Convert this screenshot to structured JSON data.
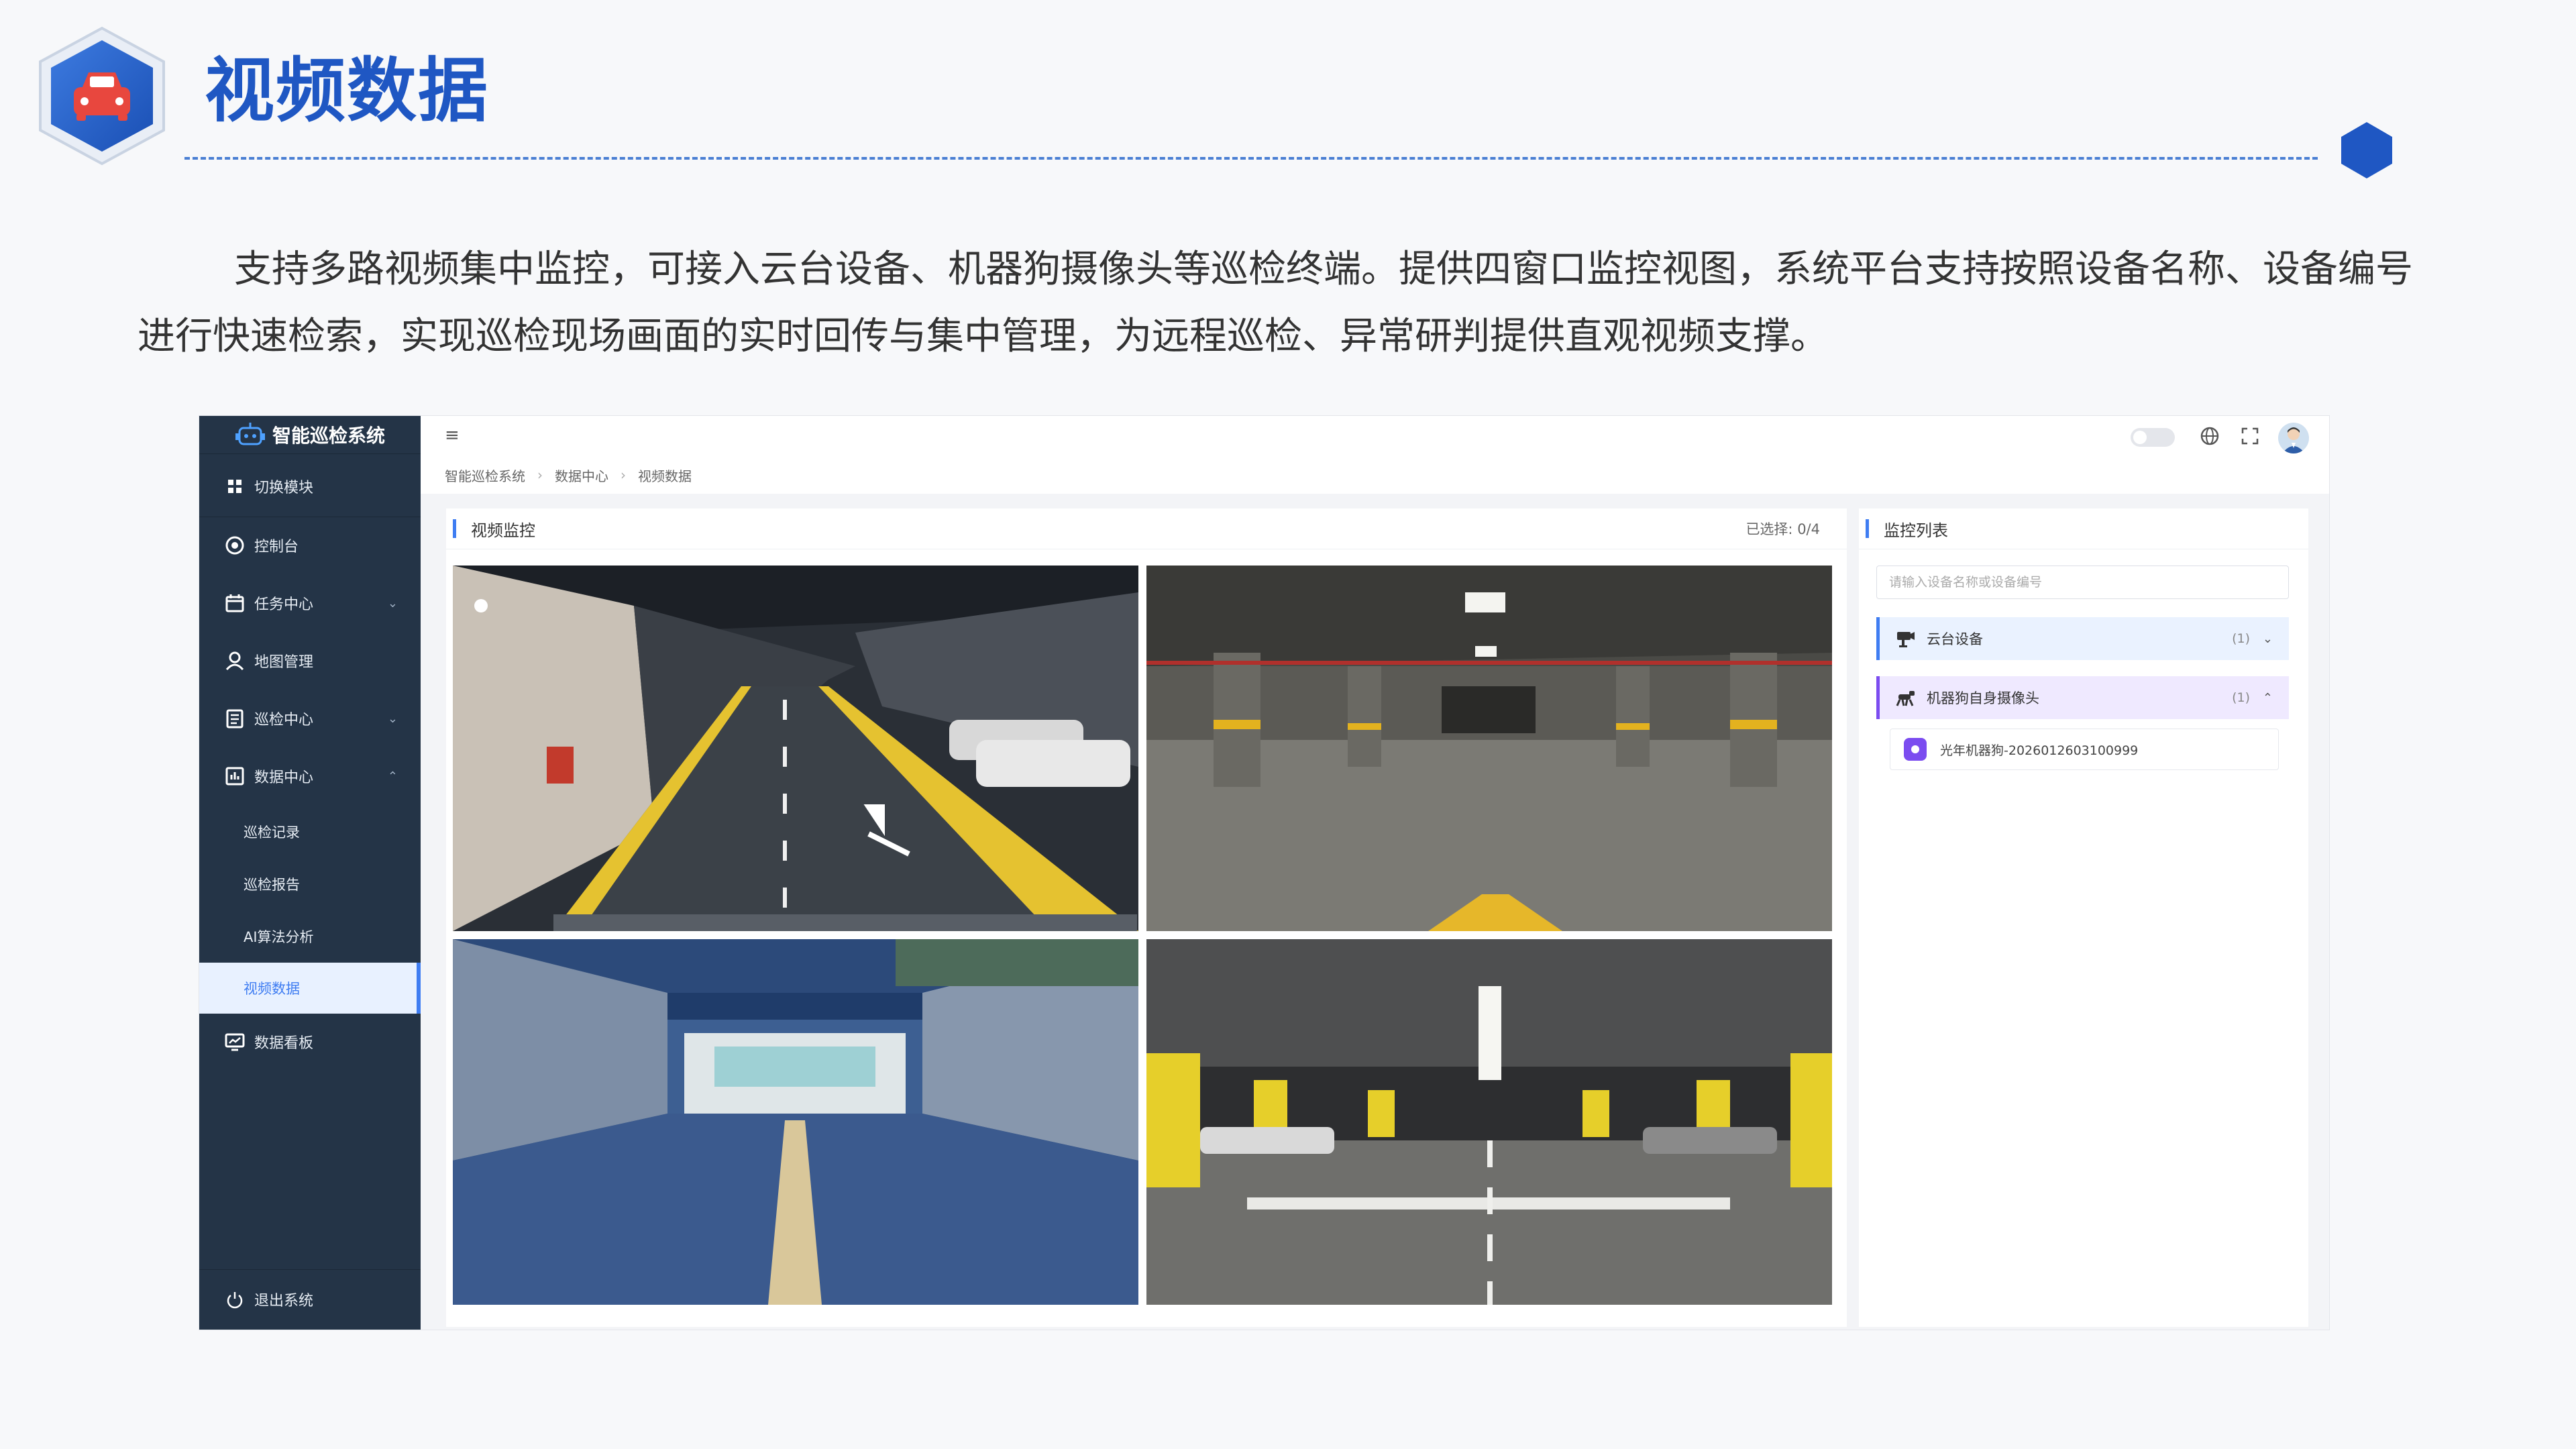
{
  "slide": {
    "title": "视频数据",
    "description": "支持多路视频集中监控，可接入云台设备、机器狗摄像头等巡检终端。提供四窗口监控视图，系统平台支持按照设备名称、设备编号进行快速检索，实现巡检现场画面的实时回传与集中管理，为远程巡检、异常研判提供直观视频支撑。",
    "logo_icon": "car-icon",
    "accent_color": "#1f57c3"
  },
  "app": {
    "brand": "智能巡检系统",
    "sidebar": {
      "switch_module": "切换模块",
      "items": [
        {
          "label": "控制台",
          "icon": "dashboard-icon"
        },
        {
          "label": "任务中心",
          "icon": "calendar-icon"
        },
        {
          "label": "地图管理",
          "icon": "map-user-icon"
        },
        {
          "label": "巡检中心",
          "icon": "list-icon"
        },
        {
          "label": "数据中心",
          "icon": "chart-icon"
        }
      ],
      "sub_items": [
        "巡检记录",
        "巡检报告",
        "AI算法分析",
        "视频数据"
      ],
      "data_board": "数据看板",
      "logout": "退出系统"
    },
    "breadcrumb": [
      "智能巡检系统",
      "数据中心",
      "视频数据"
    ],
    "video_panel": {
      "title": "视频监控",
      "selected": "已选择: 0/4"
    },
    "monitor_list": {
      "title": "监控列表",
      "search_placeholder": "请输入设备名称或设备编号",
      "groups": [
        {
          "label": "云台设备",
          "count": "(1)",
          "icon": "ptz-camera-icon"
        },
        {
          "label": "机器狗自身摄像头",
          "count": "(1)",
          "icon": "robot-dog-icon"
        }
      ],
      "device": "光年机器狗-2026012603100999"
    },
    "active_color": "#3f7df2",
    "sidebar_color": "#243447"
  }
}
